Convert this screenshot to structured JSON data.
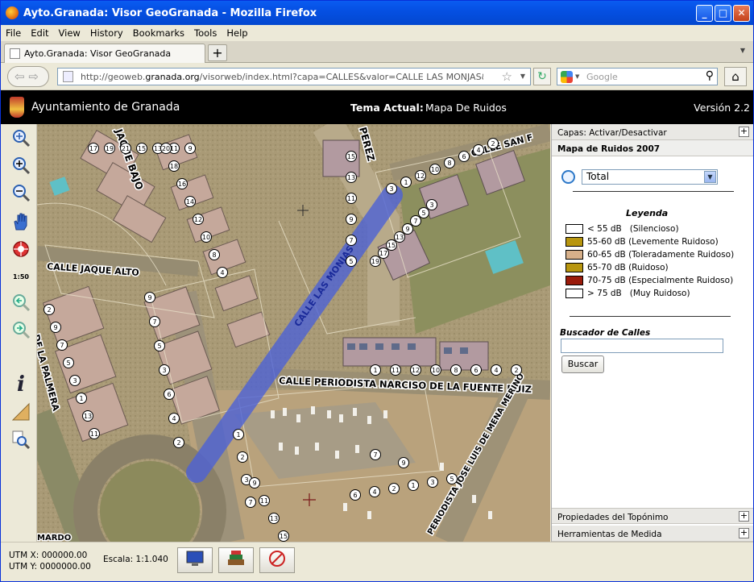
{
  "window": {
    "title": "Ayto.Granada: Visor GeoGranada - Mozilla Firefox",
    "min": "_",
    "max": "□",
    "close": "✕"
  },
  "menu": [
    "File",
    "Edit",
    "View",
    "History",
    "Bookmarks",
    "Tools",
    "Help"
  ],
  "tab": {
    "label": "Ayto.Granada: Visor GeoGranada",
    "new_tab": "+"
  },
  "nav": {
    "url_prefix": "http://geoweb.",
    "url_domain": "granada.org",
    "url_rest": "/visorweb/index.html?capa=CALLES&valor=CALLE LAS MONJAS&tema=Mapa de",
    "search_placeholder": "Google"
  },
  "header": {
    "org": "Ayuntamiento de Granada",
    "tema_label": "Tema Actual:",
    "tema_value": "Mapa De Ruidos",
    "version": "Versión 2.2"
  },
  "toolbar": {
    "scale_tool": "1:50",
    "info_tool": "i"
  },
  "map": {
    "streets": [
      "JAQUE BAJO",
      "PEREZ",
      "CALLE SAN F",
      "CALLE JAQUE ALTO",
      "CALLE LAS MONJAS",
      "CALLE PERIODISTA NARCISO DE LA FUENTE RUIZ",
      "DE LA PALMERA",
      "PERIODISTA JOSE LUIS DE MENA MERINO",
      "MARDO"
    ],
    "house_numbers": [
      "17",
      "19",
      "21",
      "15",
      "13",
      "11",
      "9",
      "20",
      "18",
      "16",
      "14",
      "12",
      "10",
      "8",
      "4",
      "2",
      "9",
      "7",
      "5",
      "3",
      "1",
      "13",
      "11",
      "9",
      "7",
      "5",
      "3",
      "6",
      "4",
      "2",
      "15",
      "13",
      "11",
      "9",
      "7",
      "5",
      "3",
      "1",
      "12",
      "10",
      "8",
      "6",
      "4",
      "2",
      "19",
      "17",
      "15",
      "13",
      "9",
      "7",
      "5",
      "3",
      "1",
      "11",
      "12",
      "10",
      "8",
      "6",
      "4",
      "2",
      "1",
      "2",
      "3",
      "7",
      "9",
      "11",
      "13",
      "15",
      "10",
      "8",
      "6",
      "4",
      "2",
      "1",
      "3",
      "5",
      "7",
      "9"
    ]
  },
  "panel": {
    "capas": "Capas: Activar/Desactivar",
    "mapa": "Mapa de Ruidos 2007",
    "tema_select": "Total",
    "leyenda_title": "Leyenda",
    "leyenda": [
      {
        "range": "< 55 dB",
        "desc": "(Silencioso)",
        "color": "#ffffff"
      },
      {
        "range": "55-60 dB",
        "desc": "(Levemente Ruidoso)",
        "color": "#b8960f"
      },
      {
        "range": "60-65 dB",
        "desc": "(Toleradamente Ruidoso)",
        "color": "#d7b08a"
      },
      {
        "range": "65-70 dB",
        "desc": "(Ruidoso)",
        "color": "#b8960f"
      },
      {
        "range": "70-75 dB",
        "desc": "(Especialmente Ruidoso)",
        "color": "#9a1a0a"
      },
      {
        "range": "> 75 dB",
        "desc": "(Muy Ruidoso)",
        "color": "#ffffff"
      }
    ],
    "buscador_title": "Buscador de Calles",
    "buscar_btn": "Buscar",
    "propiedades": "Propiedades del Topónimo",
    "herramientas": "Herramientas de Medida",
    "plus": "+"
  },
  "status": {
    "utm_x": "UTM X: 000000.00",
    "utm_y": "UTM Y: 0000000.00",
    "escala": "Escala: 1:1.040"
  }
}
